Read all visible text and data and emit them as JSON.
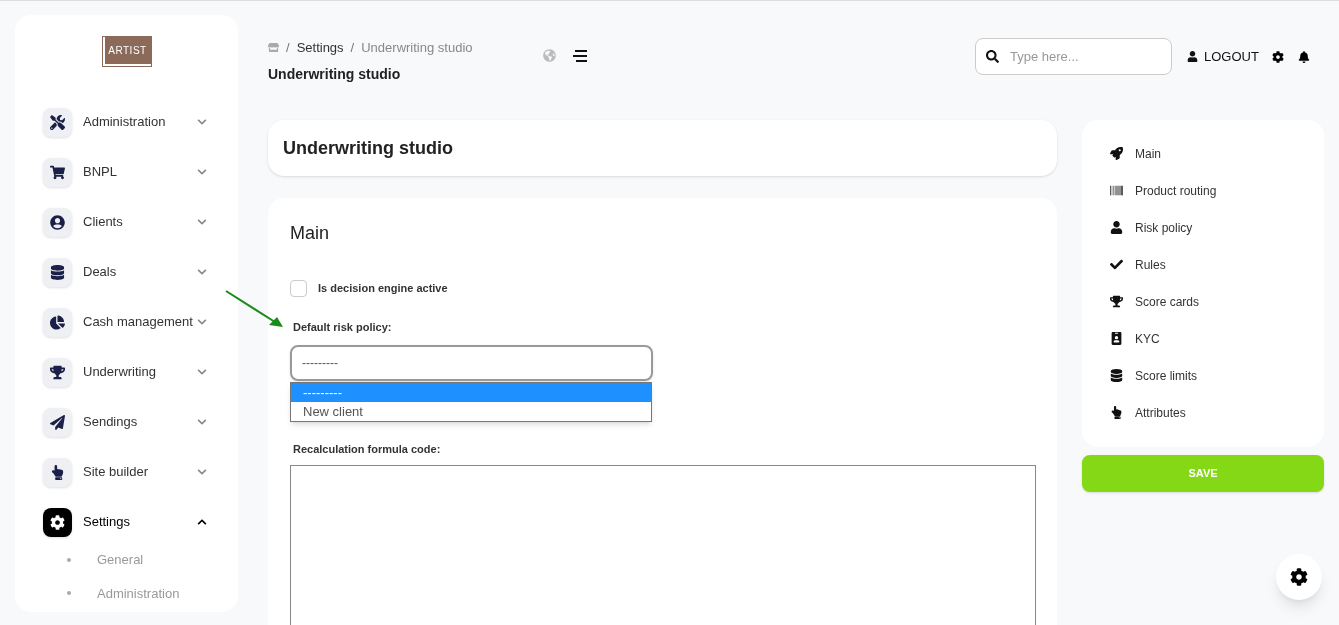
{
  "logo": {
    "text": "ARTIST"
  },
  "sidebar": {
    "items": [
      {
        "label": "Administration",
        "expanded": false
      },
      {
        "label": "BNPL",
        "expanded": false
      },
      {
        "label": "Clients",
        "expanded": false
      },
      {
        "label": "Deals",
        "expanded": false
      },
      {
        "label": "Cash management",
        "expanded": false
      },
      {
        "label": "Underwriting",
        "expanded": false
      },
      {
        "label": "Sendings",
        "expanded": false
      },
      {
        "label": "Site builder",
        "expanded": false
      },
      {
        "label": "Settings",
        "expanded": true,
        "children": [
          {
            "label": "General"
          },
          {
            "label": "Administration"
          }
        ]
      }
    ]
  },
  "header": {
    "breadcrumbs": [
      {
        "separator": "/",
        "label": "Settings"
      },
      {
        "separator": "/",
        "label": "Underwriting studio"
      }
    ],
    "page_title": "Underwriting studio",
    "search": {
      "placeholder": "Type here..."
    },
    "logout": "LOGOUT"
  },
  "title_card": {
    "title": "Underwriting studio"
  },
  "form": {
    "section_title": "Main",
    "checkbox": {
      "label": "Is decision engine active",
      "checked": false
    },
    "risk_policy": {
      "label": "Default risk policy:",
      "value": "---------",
      "open": true,
      "options": [
        {
          "label": "---------",
          "selected": true
        },
        {
          "label": "New client",
          "selected": false
        }
      ]
    },
    "formula": {
      "label": "Recalculation formula code:"
    }
  },
  "right_nav": {
    "items": [
      {
        "label": "Main"
      },
      {
        "label": "Product routing"
      },
      {
        "label": "Risk policy"
      },
      {
        "label": "Rules"
      },
      {
        "label": "Score cards"
      },
      {
        "label": "KYC"
      },
      {
        "label": "Score limits"
      },
      {
        "label": "Attributes"
      }
    ]
  },
  "save_button": "SAVE"
}
